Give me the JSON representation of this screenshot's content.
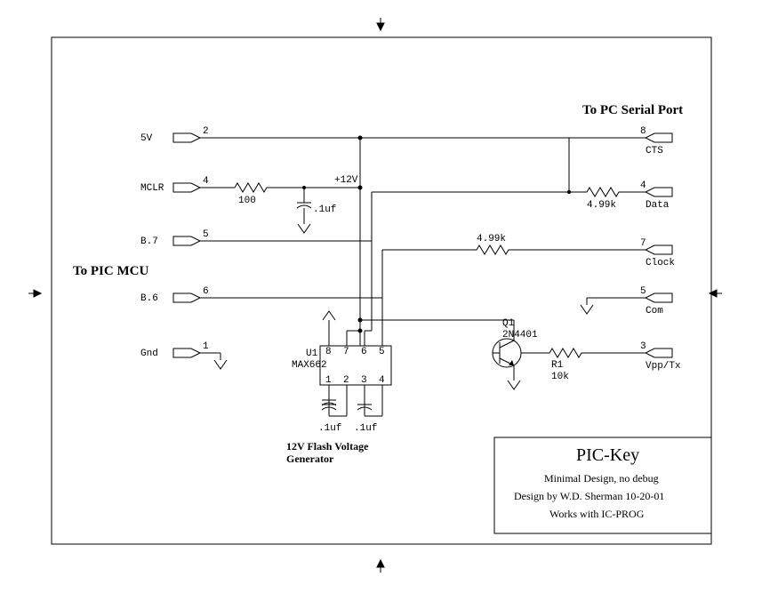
{
  "title_block": {
    "title": "PIC-Key",
    "line1": "Minimal Design, no debug",
    "line2": "Design by W.D. Sherman   10-20-01",
    "line3": "Works with IC-PROG"
  },
  "section_labels": {
    "left": "To PIC MCU",
    "right": "To PC Serial Port",
    "generator": "12V Flash Voltage",
    "generator2": "Generator"
  },
  "left_ports": {
    "p1": {
      "name": "5V",
      "pin": "2"
    },
    "p2": {
      "name": "MCLR",
      "pin": "4"
    },
    "p3": {
      "name": "B.7",
      "pin": "5"
    },
    "p4": {
      "name": "B.6",
      "pin": "6"
    },
    "p5": {
      "name": "Gnd",
      "pin": "1"
    }
  },
  "right_ports": {
    "p1": {
      "name": "CTS",
      "pin": "8"
    },
    "p2": {
      "name": "Data",
      "pin": "4"
    },
    "p3": {
      "name": "Clock",
      "pin": "7"
    },
    "p4": {
      "name": "Com",
      "pin": "5"
    },
    "p5": {
      "name": "Vpp/Tx",
      "pin": "3"
    }
  },
  "components": {
    "r_mclr": "100",
    "r_data": "4.99k",
    "r_clock": "4.99k",
    "r_base": {
      "ref": "R1",
      "val": "10k"
    },
    "c1": ".1uf",
    "c2": ".1uf",
    "c3": ".1uf",
    "u1": {
      "ref": "U1",
      "part": "MAX662",
      "pins": [
        "1",
        "2",
        "3",
        "4",
        "5",
        "6",
        "7",
        "8"
      ]
    },
    "q1": {
      "ref": "Q1",
      "part": "2N4401"
    },
    "v12": "+12V"
  }
}
